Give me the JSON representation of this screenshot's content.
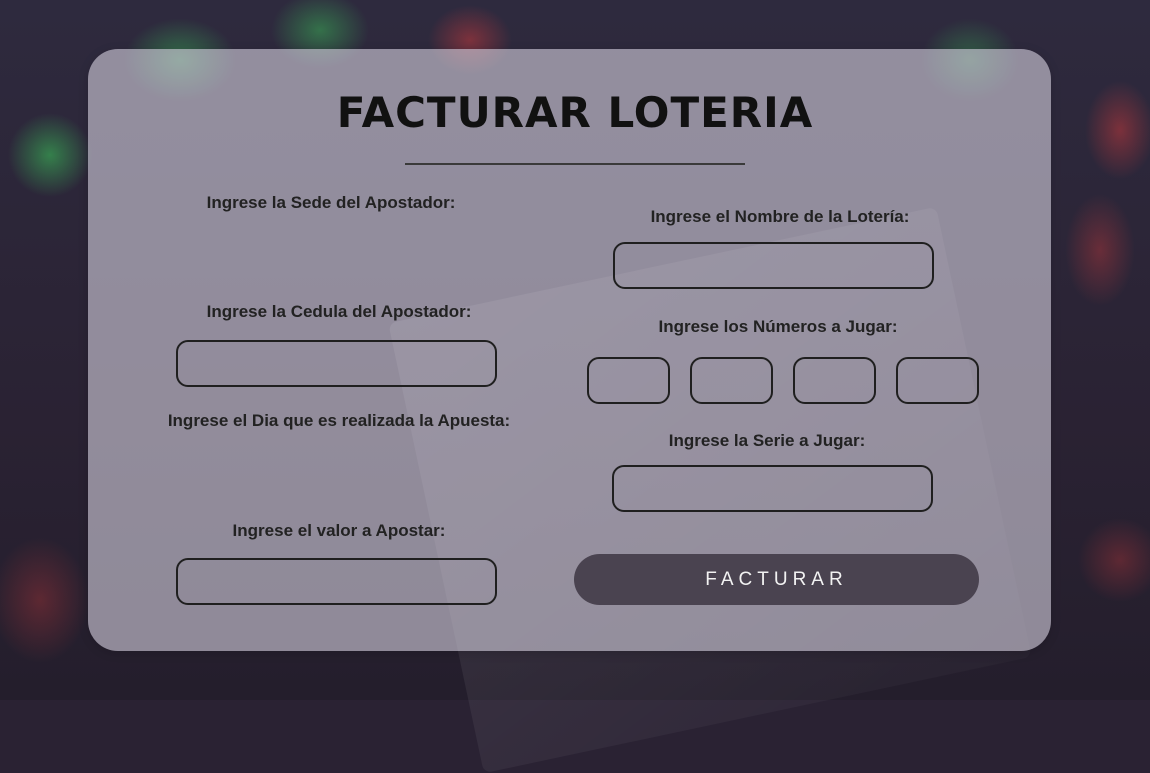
{
  "form": {
    "title": "FACTURAR LOTERIA",
    "left": {
      "sede_label": "Ingrese la Sede del Apostador:",
      "cedula_label": "Ingrese la Cedula del Apostador:",
      "cedula_value": "",
      "dia_label": "Ingrese el Dia que es realizada la Apuesta:",
      "valor_label": "Ingrese el valor a Apostar:",
      "valor_value": ""
    },
    "right": {
      "nombre_label": "Ingrese el Nombre de la Lotería:",
      "nombre_value": "",
      "numeros_label": "Ingrese los Números a Jugar:",
      "numeros_values": [
        "",
        "",
        "",
        ""
      ],
      "serie_label": "Ingrese la Serie a Jugar:",
      "serie_value": ""
    },
    "submit_label": "FACTURAR"
  },
  "colors": {
    "card": "#d2cddc",
    "button": "#4a4350",
    "button_text": "#f2f2f2",
    "field_border": "#1f1f1f",
    "text": "#222222"
  }
}
